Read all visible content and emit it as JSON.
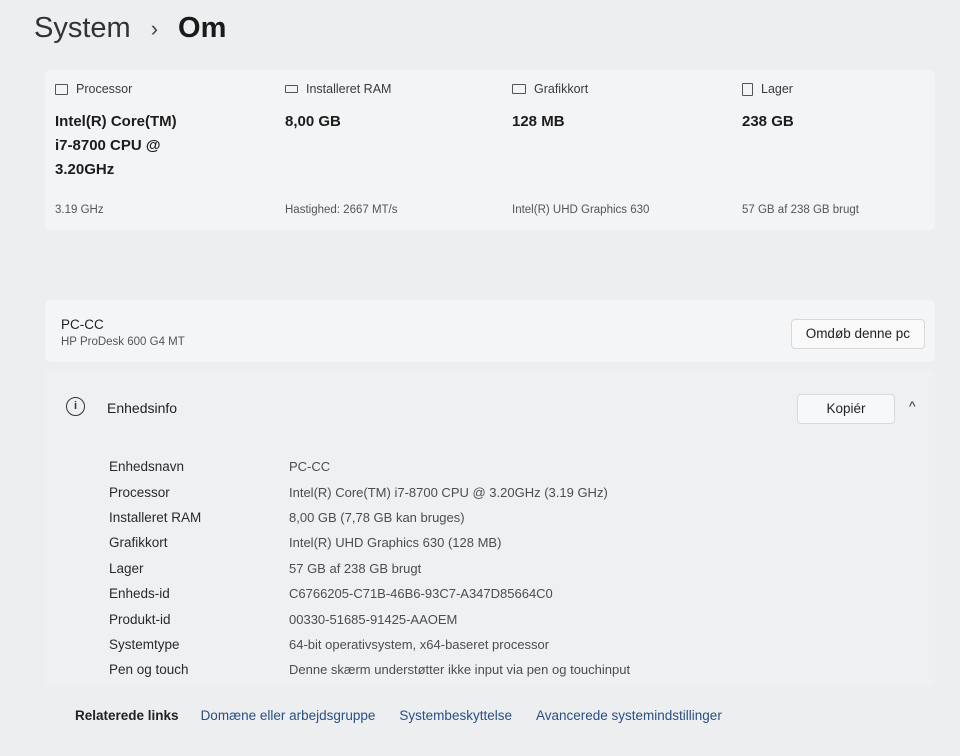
{
  "breadcrumb": {
    "root": "System",
    "separator": "›",
    "current": "Om"
  },
  "specs": [
    {
      "icon": "processor-icon",
      "label": "Processor",
      "value": "Intel(R) Core(TM)\ni7-8700 CPU @\n3.20GHz",
      "sub": "3.19 GHz"
    },
    {
      "icon": "ram-icon",
      "label": "Installeret RAM",
      "value": "8,00 GB",
      "sub": "Hastighed: 2667 MT/s"
    },
    {
      "icon": "gpu-icon",
      "label": "Grafikkort",
      "value": "128 MB",
      "sub": "Intel(R) UHD Graphics 630"
    },
    {
      "icon": "storage-icon",
      "label": "Lager",
      "value": "238 GB",
      "sub": "57 GB af 238 GB brugt"
    }
  ],
  "device": {
    "name": "PC-CC",
    "model": "HP ProDesk 600 G4 MT",
    "rename_label": "Omdøb denne pc"
  },
  "device_info": {
    "title": "Enhedsinfo",
    "copy_label": "Kopiér",
    "chevron": "^",
    "rows": [
      {
        "label": "Enhedsnavn",
        "value": "PC-CC"
      },
      {
        "label": "Processor",
        "value": "Intel(R) Core(TM) i7-8700 CPU @ 3.20GHz (3.19 GHz)"
      },
      {
        "label": "Installeret RAM",
        "value": "8,00 GB (7,78 GB kan bruges)"
      },
      {
        "label": "Grafikkort",
        "value": "Intel(R) UHD Graphics 630 (128 MB)"
      },
      {
        "label": "Lager",
        "value": "57 GB af 238 GB brugt"
      },
      {
        "label": "Enheds-id",
        "value": "C6766205-C71B-46B6-93C7-A347D85664C0"
      },
      {
        "label": "Produkt-id",
        "value": "00330-51685-91425-AAOEM"
      },
      {
        "label": "Systemtype",
        "value": "64-bit operativsystem, x64-baseret processor"
      },
      {
        "label": "Pen og touch",
        "value": "Denne skærm understøtter ikke input via pen og touchinput"
      }
    ]
  },
  "related": {
    "title": "Relaterede links",
    "links": [
      "Domæne eller arbejdsgruppe",
      "Systembeskyttelse",
      "Avancerede systemindstillinger"
    ]
  }
}
